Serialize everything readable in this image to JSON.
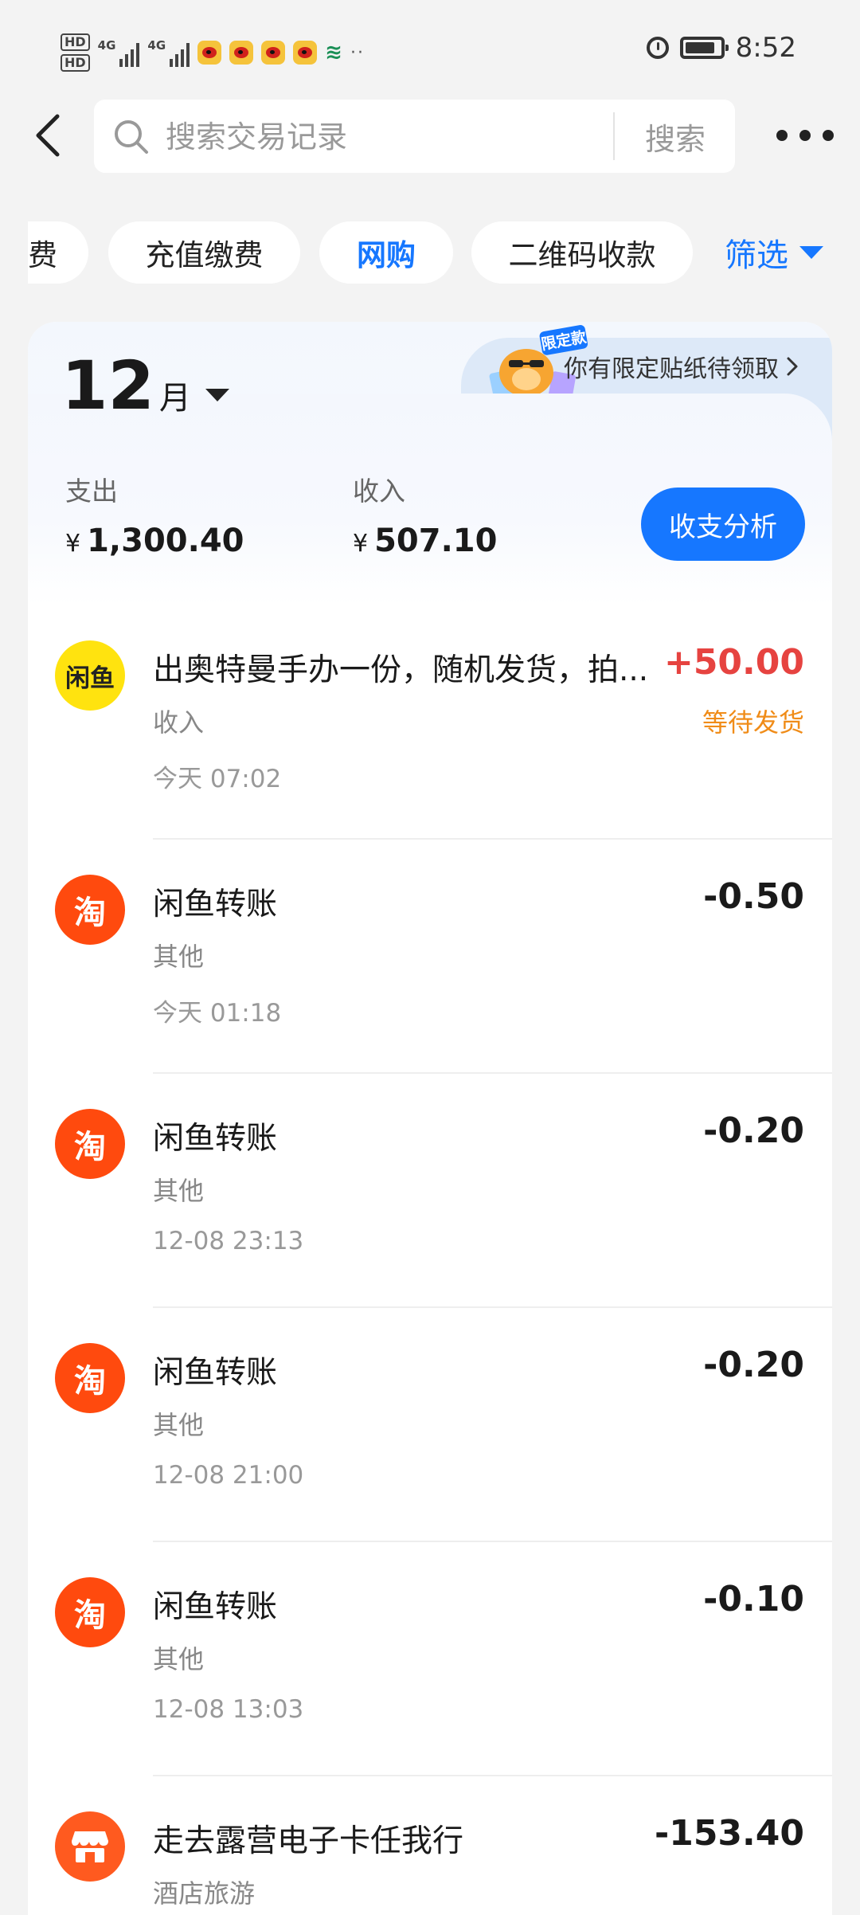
{
  "status_bar": {
    "hd1": "HD",
    "hd2": "HD",
    "net1": "4G",
    "net2": "4G",
    "more": "··",
    "time": "8:52"
  },
  "search": {
    "placeholder": "搜索交易记录",
    "button": "搜索"
  },
  "chips": [
    "费",
    "充值缴费",
    "网购",
    "二维码收款"
  ],
  "active_chip": "网购",
  "filter_label": "筛选",
  "promo": {
    "badge": "限定款",
    "text": "你有限定贴纸待领取"
  },
  "summary": {
    "month_num": "12",
    "month_unit": "月",
    "expense_label": "支出",
    "expense_currency": "¥",
    "expense_value": "1,300.40",
    "income_label": "收入",
    "income_currency": "¥",
    "income_value": "507.10",
    "analyze_button": "收支分析"
  },
  "transactions": [
    {
      "icon_text": "闲鱼",
      "icon_type": "xianyu",
      "title": "出奥特曼手办一份，随机发货，拍...",
      "category": "收入",
      "time": "今天 07:02",
      "amount": "+50.00",
      "status": "等待发货"
    },
    {
      "icon_text": "淘",
      "icon_type": "taobao",
      "title": "闲鱼转账",
      "category": "其他",
      "time": "今天 01:18",
      "amount": "-0.50",
      "status": ""
    },
    {
      "icon_text": "淘",
      "icon_type": "taobao",
      "title": "闲鱼转账",
      "category": "其他",
      "time": "12-08 23:13",
      "amount": "-0.20",
      "status": ""
    },
    {
      "icon_text": "淘",
      "icon_type": "taobao",
      "title": "闲鱼转账",
      "category": "其他",
      "time": "12-08 21:00",
      "amount": "-0.20",
      "status": ""
    },
    {
      "icon_text": "淘",
      "icon_type": "taobao",
      "title": "闲鱼转账",
      "category": "其他",
      "time": "12-08 13:03",
      "amount": "-0.10",
      "status": ""
    },
    {
      "icon_text": "",
      "icon_type": "store",
      "title": "走去露营电子卡任我行",
      "category": "酒店旅游",
      "time": "",
      "amount": "-153.40",
      "status": ""
    }
  ],
  "colors": {
    "accent": "#1677ff",
    "positive_amount": "#e64340",
    "pending_status": "#f08c18",
    "xianyu_yellow": "#ffe30f",
    "taobao_orange": "#ff4a0e",
    "store_orange": "#ff5a1f"
  },
  "icons": [
    "back-arrow-icon",
    "search-icon",
    "more-icon",
    "filter-triangle-icon",
    "caret-down-icon",
    "chevron-right-icon",
    "alarm-icon",
    "battery-icon"
  ]
}
